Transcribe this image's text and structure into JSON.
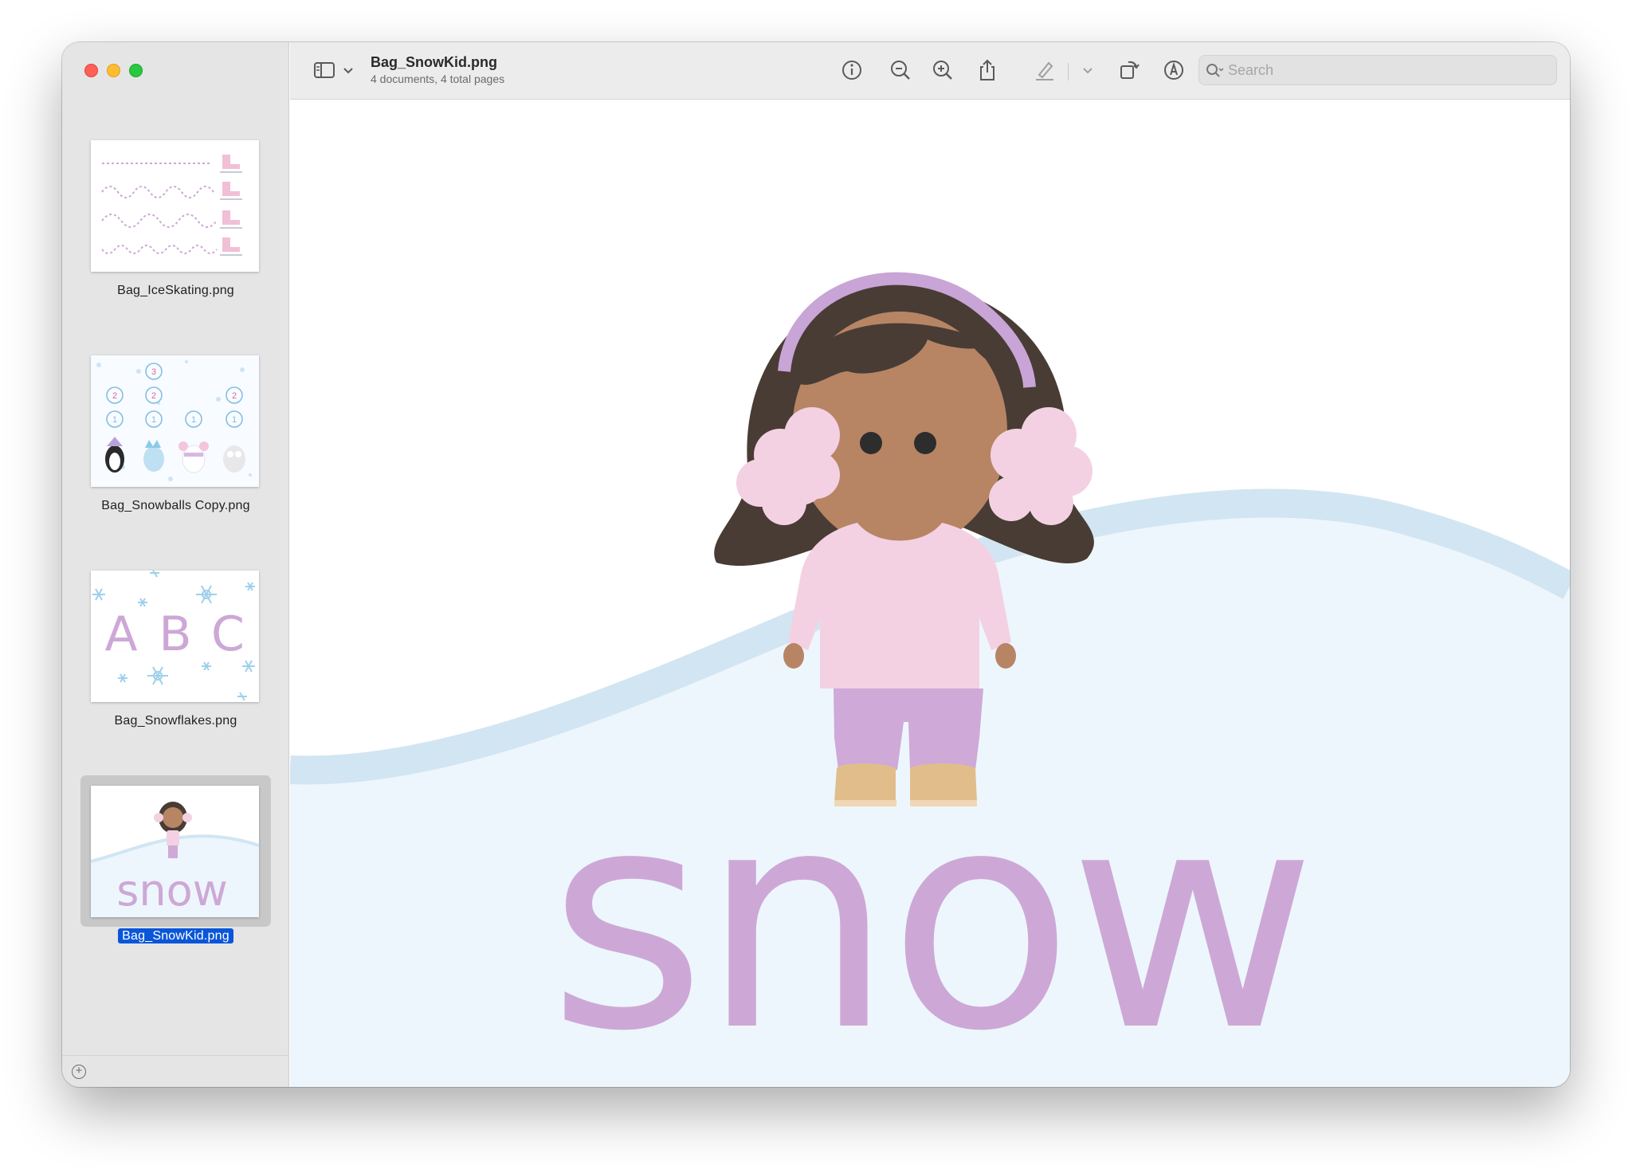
{
  "window": {
    "title": "Bag_SnowKid.png",
    "subtitle": "4 documents, 4 total pages"
  },
  "sidebar": {
    "items": [
      {
        "label": "Bag_IceSkating.png",
        "selected": false
      },
      {
        "label": "Bag_Snowballs Copy.png",
        "selected": false
      },
      {
        "label": "Bag_Snowflakes.png",
        "selected": false
      },
      {
        "label": "Bag_SnowKid.png",
        "selected": true
      }
    ],
    "thumbnails": {
      "snowballs": {
        "numbers": [
          "3",
          "2",
          "2",
          "2",
          "1",
          "1",
          "1",
          "1"
        ]
      },
      "snowflakes": {
        "letters": [
          "A",
          "B",
          "C"
        ]
      },
      "snowkid": {
        "word": "snow"
      }
    }
  },
  "toolbar": {
    "icons": [
      "sidebar-toggle-icon",
      "chevron-down-icon",
      "info-icon",
      "zoom-out-icon",
      "zoom-in-icon",
      "share-icon",
      "highlight-pen-icon",
      "chevron-down-icon",
      "rotate-icon",
      "markup-icon",
      "form-fill-icon"
    ],
    "search": {
      "placeholder": "Search",
      "value": ""
    }
  },
  "page": {
    "word": "snow",
    "colors": {
      "word": "#cda8d6",
      "hill": "#edf6fc",
      "hill_stripe": "#d2e5f2",
      "hair": "#483c35",
      "skin": "#b78564",
      "earmuff": "#f3d1e3",
      "headband": "#c9a4d6",
      "sweater": "#f3d1e3",
      "pants": "#cfa9d8",
      "boots": "#e1bd8c"
    }
  },
  "colors": {
    "accent": "#0a56d8",
    "sidebar_bg": "#e5e5e5",
    "toolbar_bg": "#ececec"
  }
}
